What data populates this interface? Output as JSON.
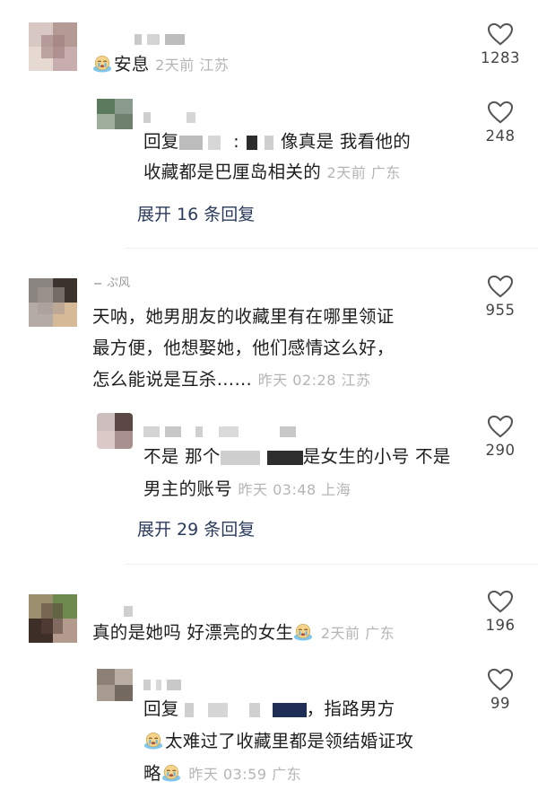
{
  "comments": [
    {
      "text": "安息",
      "meta": "2天前 江苏",
      "likes": "1283",
      "reply": {
        "text_line1_prefix": "回复",
        "text_line1_mid": "像真是 我看他的",
        "text_line2": "收藏都是巴厘岛相关的",
        "meta": "2天前 广东",
        "likes": "248"
      },
      "expand": "展开 16 条回复"
    },
    {
      "username_partial": "ぷ风",
      "text_line1": "天呐，她男朋友的收藏里有在哪里领证",
      "text_line2": "最方便，他想娶她，他们感情这么好，",
      "text_line3": "怎么能说是互杀……",
      "meta": "昨天 02:28 江苏",
      "likes": "955",
      "reply": {
        "text_line1_prefix": "不是 那个",
        "text_line1_suffix": "是女生的小号 不是",
        "text_line2": "男主的账号",
        "meta": "昨天 03:48 上海",
        "likes": "290"
      },
      "expand": "展开 29 条回复"
    },
    {
      "text": "真的是她吗 好漂亮的女生",
      "meta": "2天前 广东",
      "likes": "196",
      "reply": {
        "text_line1_prefix": "回复",
        "text_line1_suffix": "，指路男方",
        "text_line2": "太难过了收藏里都是领结婚证攻",
        "text_line3": "略",
        "meta": "昨天 03:59 广东",
        "likes": "99"
      }
    }
  ],
  "icons": {
    "like": "heart-outline-icon",
    "emoji": "crying-face-emoji"
  },
  "colors": {
    "text": "#1e1e1e",
    "meta": "#b5b5b5",
    "expand": "#2b3b5c",
    "like_icon": "#555555"
  }
}
